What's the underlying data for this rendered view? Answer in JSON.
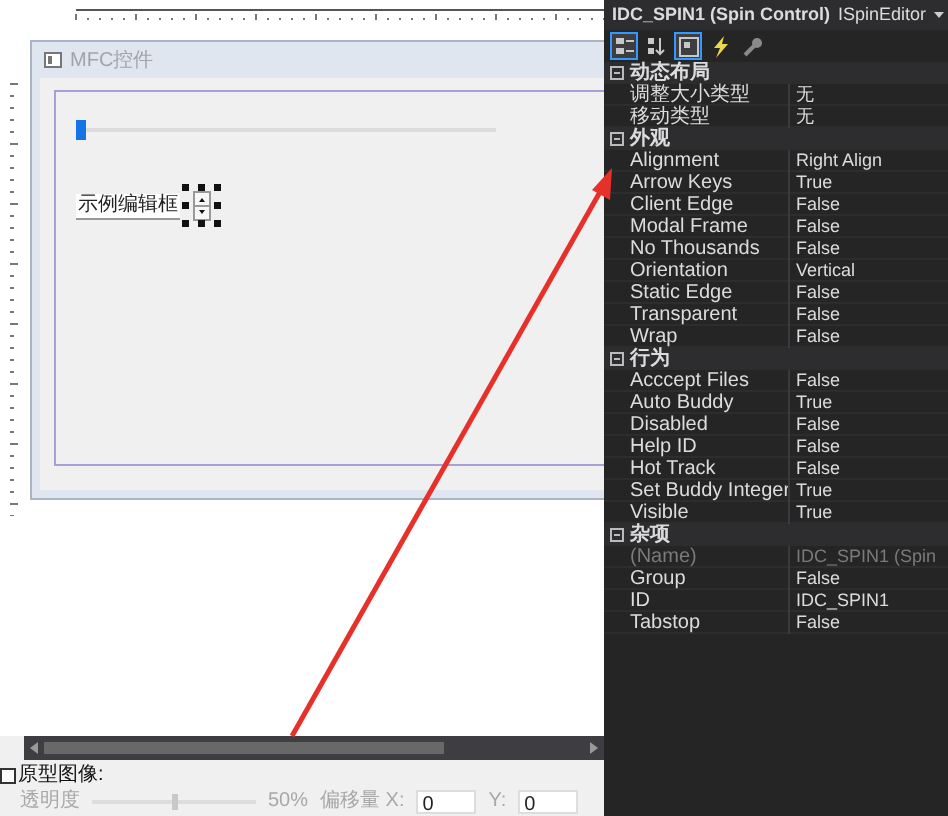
{
  "designer": {
    "dialog_title": "MFC控件",
    "slider": {
      "level": 0
    },
    "static_label": "示例编辑框"
  },
  "bottom_bar": {
    "prototype_checkbox": {
      "label": "原型图像:",
      "checked": false
    },
    "opacity_label": "透明度",
    "opacity_slider": {
      "level": 0.5,
      "disabled": true
    },
    "opacity_reading": "50%",
    "offset_label": "偏移量 X:",
    "x_value": "0",
    "y_label": "Y:",
    "y_value": "0"
  },
  "properties": {
    "title": "IDC_SPIN1 (Spin Control)",
    "editor": "ISpinEditor",
    "toolbar": [
      {
        "kind": "categorized",
        "selected": true
      },
      {
        "kind": "alphabetical",
        "selected": false
      },
      {
        "kind": "properties",
        "selected": true
      },
      {
        "kind": "events",
        "selected": false
      },
      {
        "kind": "pages",
        "selected": false
      }
    ],
    "categories": [
      {
        "name": "动态布局",
        "expanded": true,
        "items": [
          {
            "name": "调整大小类型",
            "value": "无",
            "disabled": false
          },
          {
            "name": "移动类型",
            "value": "无",
            "disabled": false
          }
        ]
      },
      {
        "name": "外观",
        "expanded": true,
        "items": [
          {
            "name": "Alignment",
            "value": "Right Align",
            "disabled": false
          },
          {
            "name": "Arrow Keys",
            "value": "True",
            "disabled": false
          },
          {
            "name": "Client Edge",
            "value": "False",
            "disabled": false
          },
          {
            "name": "Modal Frame",
            "value": "False",
            "disabled": false
          },
          {
            "name": "No Thousands",
            "value": "False",
            "disabled": false
          },
          {
            "name": "Orientation",
            "value": "Vertical",
            "disabled": false
          },
          {
            "name": "Static Edge",
            "value": "False",
            "disabled": false
          },
          {
            "name": "Transparent",
            "value": "False",
            "disabled": false
          },
          {
            "name": "Wrap",
            "value": "False",
            "disabled": false
          }
        ]
      },
      {
        "name": "行为",
        "expanded": true,
        "items": [
          {
            "name": "Acccept Files",
            "value": "False",
            "disabled": false
          },
          {
            "name": "Auto Buddy",
            "value": "True",
            "disabled": false
          },
          {
            "name": "Disabled",
            "value": "False",
            "disabled": false
          },
          {
            "name": "Help ID",
            "value": "False",
            "disabled": false
          },
          {
            "name": "Hot Track",
            "value": "False",
            "disabled": false
          },
          {
            "name": "Set Buddy Integer",
            "value": "True",
            "disabled": false
          },
          {
            "name": "Visible",
            "value": "True",
            "disabled": false
          }
        ]
      },
      {
        "name": "杂项",
        "expanded": true,
        "items": [
          {
            "name": "(Name)",
            "value": "IDC_SPIN1 (Spin",
            "disabled": true
          },
          {
            "name": "Group",
            "value": "False",
            "disabled": false
          },
          {
            "name": "ID",
            "value": "IDC_SPIN1",
            "disabled": false
          },
          {
            "name": "Tabstop",
            "value": "False",
            "disabled": false
          }
        ]
      }
    ]
  }
}
